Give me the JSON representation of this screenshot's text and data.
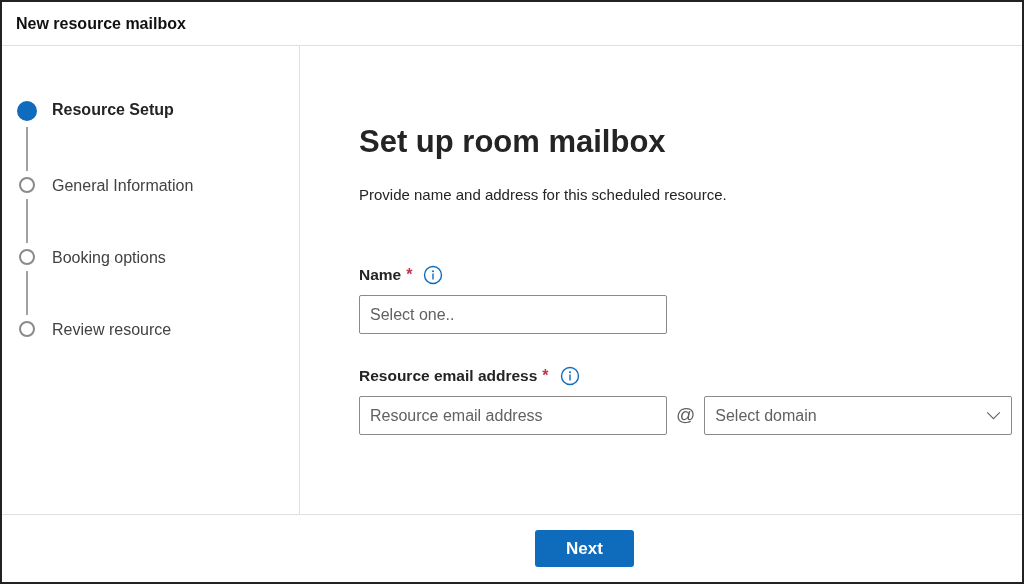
{
  "window": {
    "title": "New resource mailbox"
  },
  "steps": [
    {
      "label": "Resource Setup",
      "selected": true
    },
    {
      "label": "General Information",
      "selected": false
    },
    {
      "label": "Booking options",
      "selected": false
    },
    {
      "label": "Review resource",
      "selected": false
    }
  ],
  "heading": "Set up room mailbox",
  "description": "Provide name and address for this scheduled resource.",
  "name_field": {
    "label": "Name",
    "required_mark": "*",
    "placeholder": "Select one.."
  },
  "email_field": {
    "label": "Resource email address",
    "required_mark": "*",
    "placeholder": "Resource email address",
    "separator": "@",
    "domain_placeholder": "Select domain"
  },
  "buttons": [
    "Next"
  ]
}
